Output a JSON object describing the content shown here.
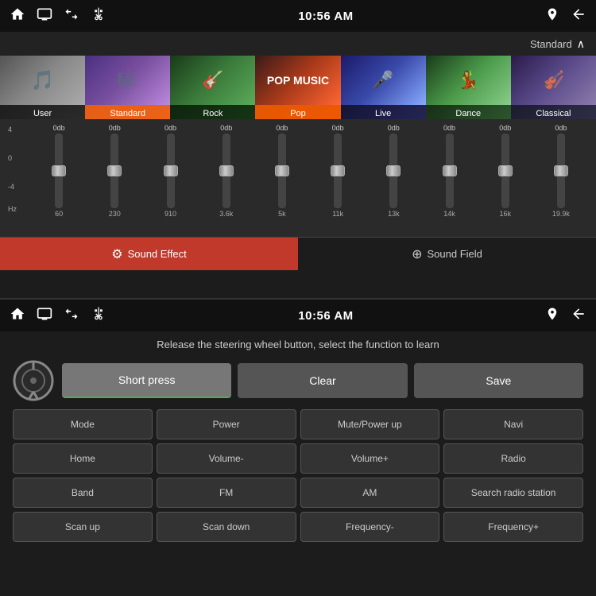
{
  "topPanel": {
    "statusBar": {
      "time": "10:56 AM",
      "icons": [
        "home",
        "screen",
        "up-arrows",
        "usb",
        "location",
        "back"
      ]
    },
    "profileBar": {
      "label": "Standard",
      "chevron": "∧"
    },
    "profiles": [
      {
        "id": "user",
        "label": "User",
        "active": false
      },
      {
        "id": "standard",
        "label": "Standard",
        "active": true
      },
      {
        "id": "rock",
        "label": "Rock",
        "active": false
      },
      {
        "id": "pop",
        "label": "Pop",
        "active": false
      },
      {
        "id": "live",
        "label": "Live",
        "active": false
      },
      {
        "id": "dance",
        "label": "Dance",
        "active": false
      },
      {
        "id": "classical",
        "label": "Classical",
        "active": false
      }
    ],
    "eq": {
      "dbLabels": [
        "4",
        "0",
        "-4"
      ],
      "freqLabel": "Hz",
      "bands": [
        {
          "freq": "60",
          "db": "0db"
        },
        {
          "freq": "230",
          "db": "0db"
        },
        {
          "freq": "910",
          "db": "0db"
        },
        {
          "freq": "3.6k",
          "db": "0db"
        },
        {
          "freq": "5k",
          "db": "0db"
        },
        {
          "freq": "11k",
          "db": "0db"
        },
        {
          "freq": "13k",
          "db": "0db"
        },
        {
          "freq": "14k",
          "db": "0db"
        },
        {
          "freq": "16k",
          "db": "0db"
        },
        {
          "freq": "19.9k",
          "db": "0db"
        }
      ]
    },
    "tabs": [
      {
        "id": "sound-effect",
        "icon": "⚙",
        "label": "Sound Effect",
        "active": true
      },
      {
        "id": "sound-field",
        "icon": "⊕",
        "label": "Sound Field",
        "active": false
      }
    ]
  },
  "bottomPanel": {
    "statusBar": {
      "time": "10:56 AM"
    },
    "instruction": "Release the steering wheel button, select the function to learn",
    "actionButtons": [
      {
        "id": "short-press",
        "label": "Short press",
        "active": true
      },
      {
        "id": "clear",
        "label": "Clear",
        "active": false
      },
      {
        "id": "save",
        "label": "Save",
        "active": false
      }
    ],
    "functionButtons": [
      "Mode",
      "Power",
      "Mute/Power up",
      "Navi",
      "Home",
      "Volume-",
      "Volume+",
      "Radio",
      "Band",
      "FM",
      "AM",
      "Search radio station",
      "Scan up",
      "Scan down",
      "Frequency-",
      "Frequency+"
    ]
  }
}
